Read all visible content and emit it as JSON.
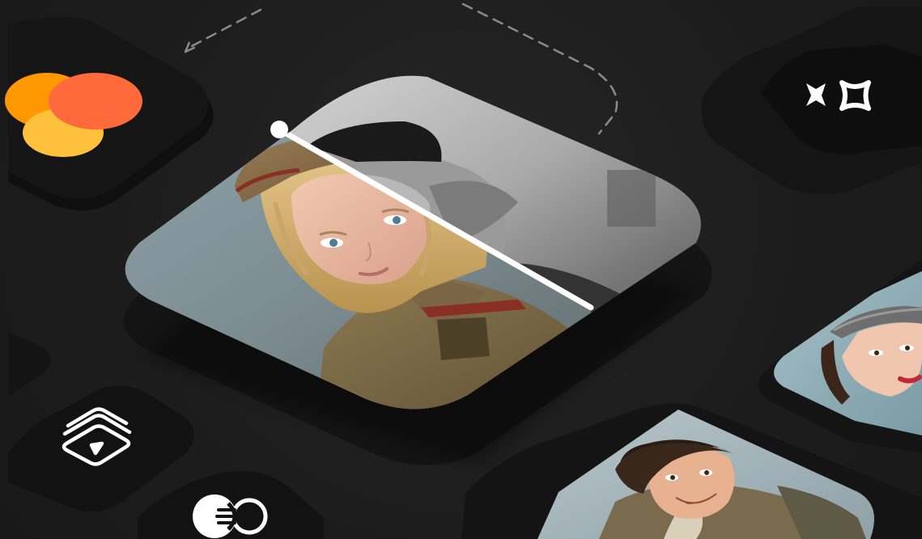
{
  "scene": {
    "description_label": "",
    "colors": {
      "background": "#1f1f1f",
      "tile_dark": "#121212",
      "tile_shadow": "#0d0d0d",
      "slider_line": "#ffffff",
      "dashed_path": "#8a8a8a",
      "app_icon_orange": "#ff9800",
      "app_icon_red": "#ff6a3d",
      "app_icon_yellow": "#ffc13b"
    },
    "icons": [
      {
        "name": "colorize-app-logo-icon"
      },
      {
        "name": "sparkle-enhance-icon"
      },
      {
        "name": "layered-video-icon"
      },
      {
        "name": "color-toggle-icon"
      }
    ],
    "images": [
      {
        "name": "main-before-after-portrait"
      },
      {
        "name": "woman-in-cap-portrait"
      },
      {
        "name": "smiling-man-portrait"
      }
    ],
    "slider": {
      "name": "before-after-slider",
      "state": "split"
    }
  }
}
